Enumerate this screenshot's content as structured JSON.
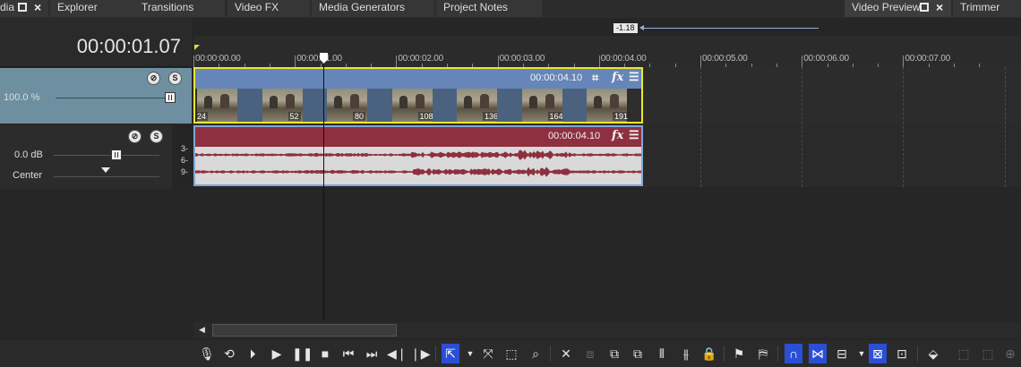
{
  "tabs": {
    "left_partial": "dia",
    "explorer": "Explorer",
    "transitions": "Transitions",
    "video_fx": "Video FX",
    "media_generators": "Media Generators",
    "project_notes": "Project Notes",
    "video_preview": "Video Preview",
    "trimmer": "Trimmer"
  },
  "timecode": "00:00:01.07",
  "hint_value": "-1.18",
  "ruler": {
    "labels": [
      "00:00:00.00",
      "00:00:01.00",
      "00:00:02.00",
      "00:00:03.00",
      "00:00:04.00",
      "00:00:05.00",
      "00:00:06.00",
      "00:00:07.00"
    ]
  },
  "video_track": {
    "level": "100.0 %",
    "level_fraction": 1.0,
    "event_length": "00:00:04.10",
    "frame_numbers": [
      "24",
      "52",
      "80",
      "108",
      "136",
      "164",
      "191"
    ]
  },
  "audio_track": {
    "volume": "0.0 dB",
    "pan": "Center",
    "event_length": "00:00:04.10",
    "db_scale": [
      "3-",
      "6-",
      "9-"
    ]
  },
  "icons": {
    "mute": "mute-icon",
    "solo": "solo-icon",
    "crop": "crop-icon",
    "fx": "fx",
    "menu": "menu-icon"
  },
  "colors": {
    "video_event_border": "#e8e82f",
    "video_event_header": "#6685b8",
    "audio_event_header": "#8e3040",
    "audio_event_border": "#7fa8d6",
    "active_tool": "#2a4fd6"
  }
}
